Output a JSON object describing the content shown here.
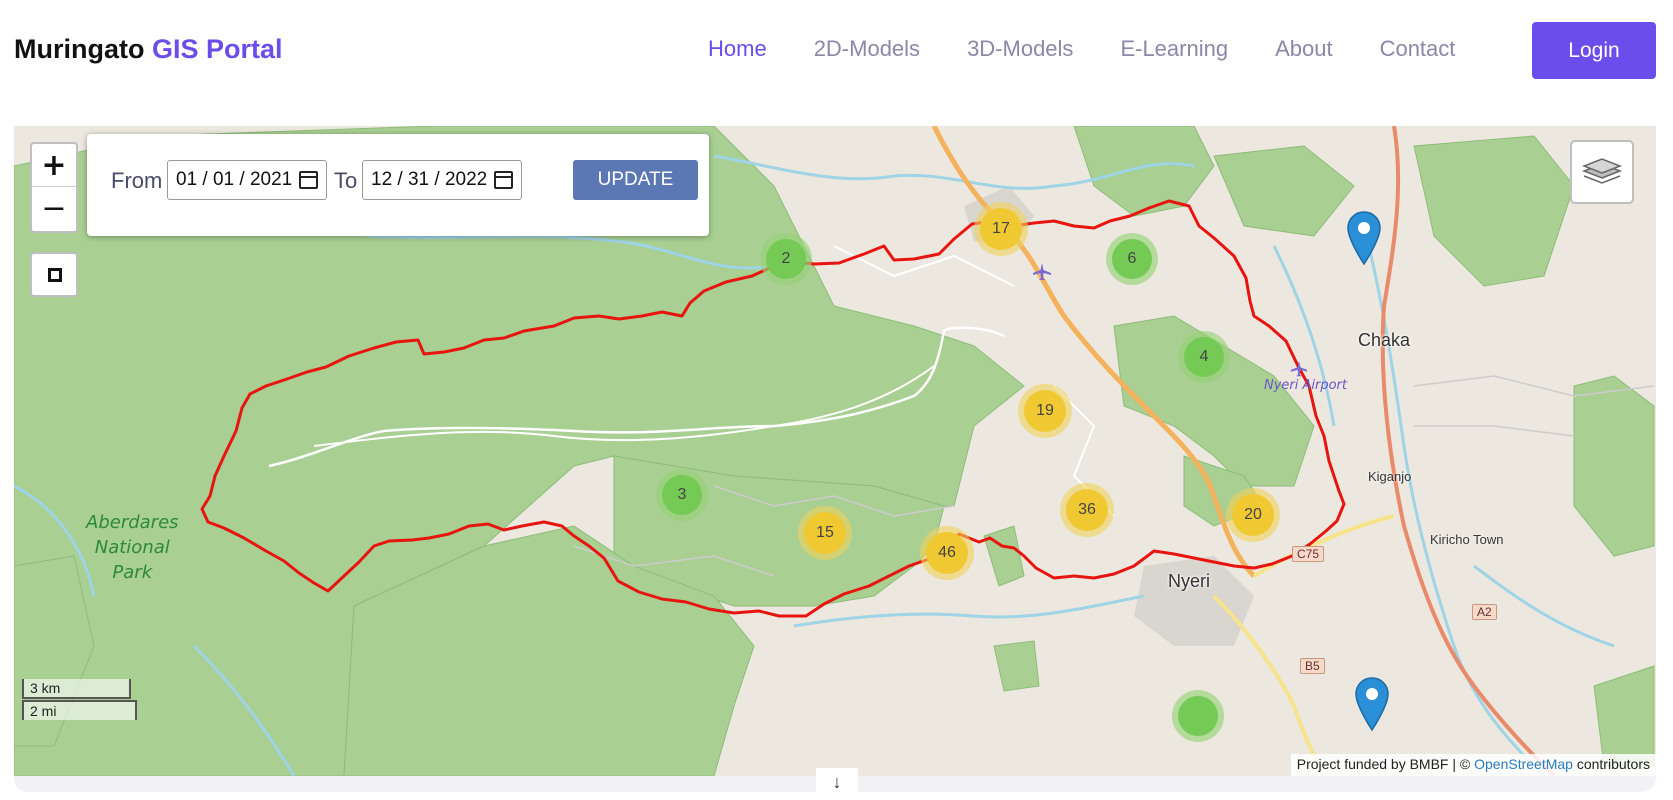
{
  "header": {
    "brand_primary": "Muringato",
    "brand_accent": "GIS Portal",
    "nav": [
      {
        "label": "Home",
        "active": true
      },
      {
        "label": "2D-Models",
        "active": false
      },
      {
        "label": "3D-Models",
        "active": false
      },
      {
        "label": "E-Learning",
        "active": false
      },
      {
        "label": "About",
        "active": false
      },
      {
        "label": "Contact",
        "active": false
      }
    ],
    "login_label": "Login",
    "accent_color": "#6a4dea"
  },
  "map": {
    "controls": {
      "zoom_in": "+",
      "zoom_out": "−",
      "draw_icon": "square-draw-icon",
      "layers_icon": "layers-icon"
    },
    "date_filter": {
      "from_label": "From",
      "from_value": "01 / 01 / 2021",
      "to_label": "To",
      "to_value": "12 / 31 / 2022",
      "update_label": "UPDATE"
    },
    "clusters": [
      {
        "count": "2",
        "level": "green"
      },
      {
        "count": "17",
        "level": "yellow"
      },
      {
        "count": "6",
        "level": "green"
      },
      {
        "count": "4",
        "level": "green"
      },
      {
        "count": "19",
        "level": "yellow"
      },
      {
        "count": "3",
        "level": "green"
      },
      {
        "count": "15",
        "level": "yellow"
      },
      {
        "count": "46",
        "level": "yellow"
      },
      {
        "count": "36",
        "level": "yellow"
      },
      {
        "count": "20",
        "level": "yellow"
      }
    ],
    "labels": {
      "park_line1": "Aberdares",
      "park_line2": "National",
      "park_line3": "Park",
      "chaka": "Chaka",
      "airport": "Nyeri Airport",
      "kiganjo": "Kiganjo",
      "kiricho": "Kiricho Town",
      "nyeri": "Nyeri",
      "road_c75": "C75",
      "road_a2": "A2",
      "road_b5": "B5"
    },
    "scale": {
      "km": "3 km",
      "mi": "2 mi"
    },
    "attribution": {
      "prefix": "Project funded by BMBF | ©",
      "link": "OpenStreetMap",
      "suffix": "contributors"
    },
    "boundary_color": "#e8140f",
    "scroll_hint_icon": "arrow-down-icon"
  }
}
